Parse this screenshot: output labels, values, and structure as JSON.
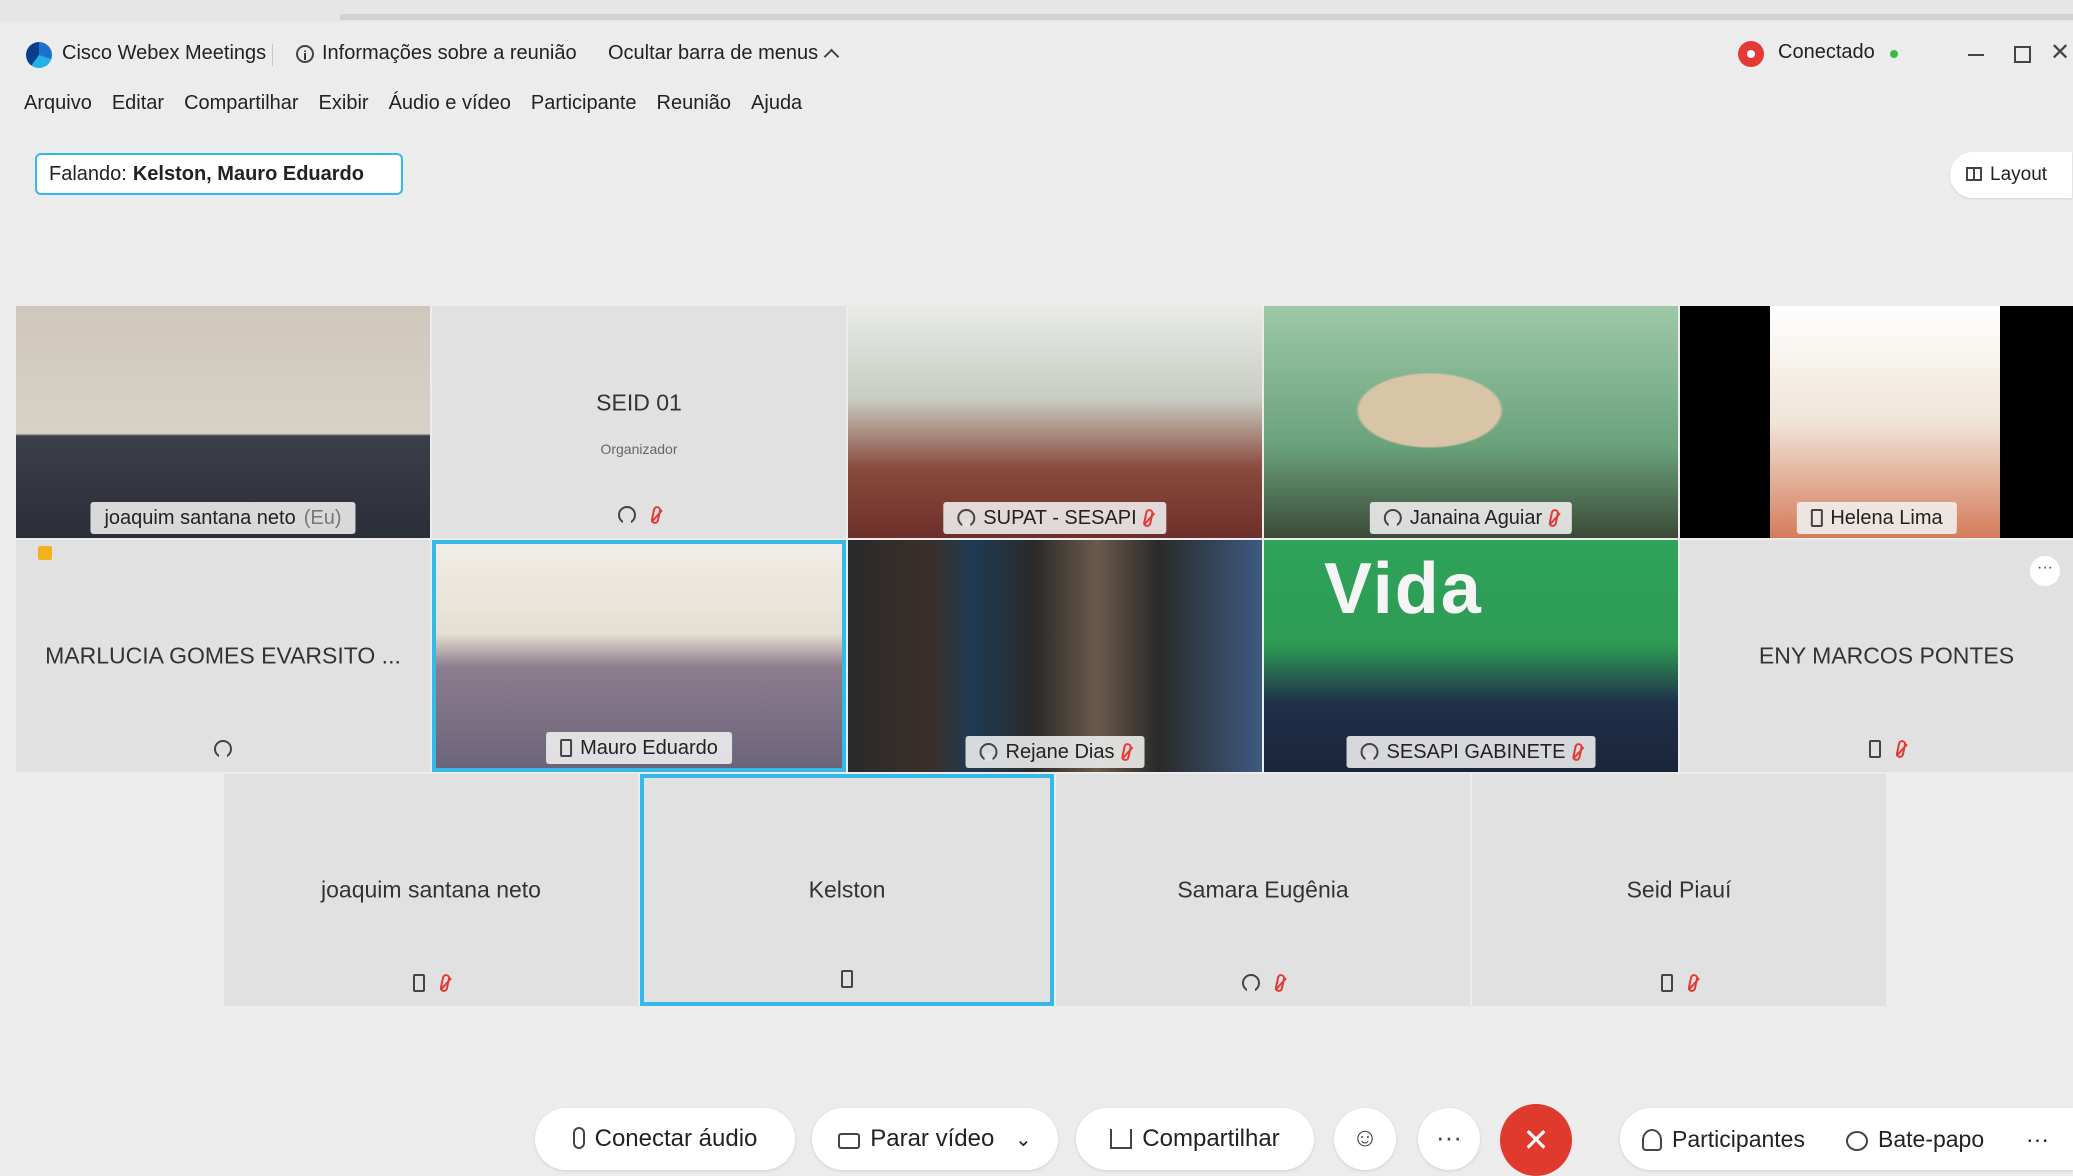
{
  "window": {
    "app_title": "Cisco Webex Meetings",
    "meeting_info": "Informações sobre a reunião",
    "hide_menu": "Ocultar barra de menus",
    "status": "Conectado",
    "close_glyph": "✕"
  },
  "menu": [
    "Arquivo",
    "Editar",
    "Compartilhar",
    "Exibir",
    "Áudio e vídeo",
    "Participante",
    "Reunião",
    "Ajuda"
  ],
  "speaking": {
    "label": "Falando:",
    "names": "Kelston, Mauro Eduardo"
  },
  "layout_label": "Layout",
  "tiles": {
    "joaquim_eu": {
      "name": "joaquim santana neto",
      "suffix": "(Eu)"
    },
    "seid01": {
      "name": "SEID 01",
      "role": "Organizador"
    },
    "supat": {
      "name": "SUPAT - SESAPI"
    },
    "janaina": {
      "name": "Janaina Aguiar"
    },
    "helena": {
      "name": "Helena Lima"
    },
    "marlucia": {
      "name": "MARLUCIA GOMES EVARSITO ..."
    },
    "mauro": {
      "name": "Mauro Eduardo"
    },
    "rejane": {
      "name": "Rejane Dias"
    },
    "gabinete": {
      "name": "SESAPI GABINETE",
      "banner": "Vida"
    },
    "eny": {
      "name": "ENY MARCOS PONTES",
      "more": "···"
    },
    "joaquim2": {
      "name": "joaquim santana neto"
    },
    "kelston": {
      "name": "Kelston"
    },
    "samara": {
      "name": "Samara Eugênia"
    },
    "seid_piaui": {
      "name": "Seid Piauí"
    }
  },
  "toolbar": {
    "connect_audio": "Conectar áudio",
    "stop_video": "Parar vídeo",
    "dropdown": "⌄",
    "share": "Compartilhar",
    "reactions": "☺",
    "more": "···",
    "end": "✕",
    "participants": "Participantes",
    "chat": "Bate-papo",
    "more_right": "···"
  },
  "colors": {
    "accent": "#36b9e6",
    "end_call": "#e03a2f",
    "muted": "#e53935",
    "connected": "#2fbf4a"
  }
}
